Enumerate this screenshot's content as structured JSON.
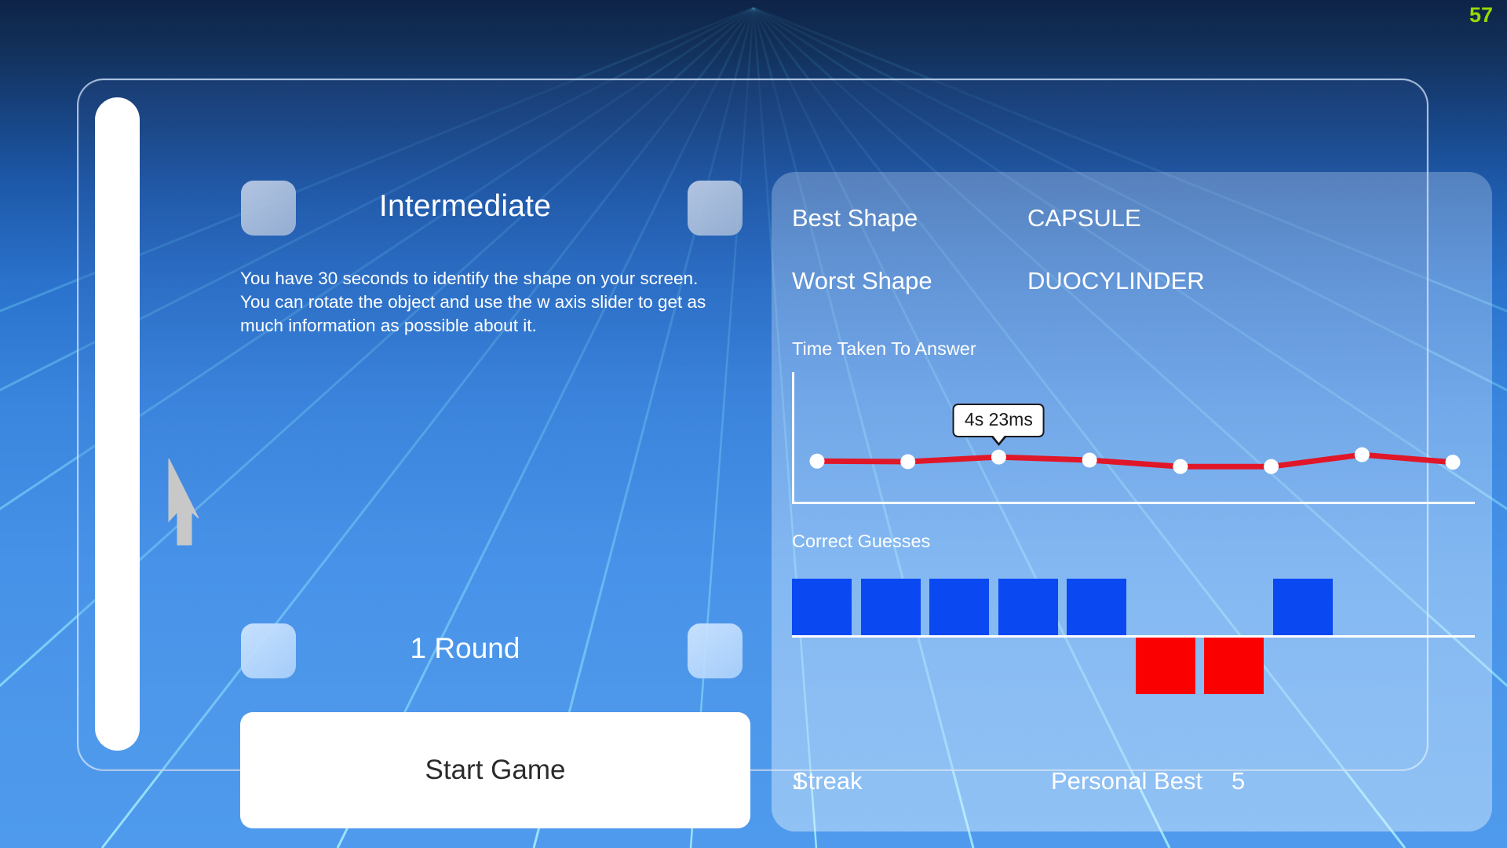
{
  "hud": {
    "score": "57"
  },
  "left": {
    "difficulty": "Intermediate",
    "description": "You have 30 seconds to identify the shape on your screen. You can rotate the object and use the w axis slider to get as much information as possible about it.",
    "rounds": "1 Round",
    "start_label": "Start Game",
    "prev_difficulty_icon": "left-arrow-icon",
    "next_difficulty_icon": "right-arrow-icon",
    "prev_round_icon": "left-arrow-icon",
    "next_round_icon": "right-arrow-icon",
    "slider_name": "w-axis-slider"
  },
  "stats": {
    "best_shape_label": "Best Shape",
    "best_shape_value": "CAPSULE",
    "worst_shape_label": "Worst Shape",
    "worst_shape_value": "DUOCYLINDER",
    "time_chart_title": "Time Taken To Answer",
    "guesses_title": "Correct Guesses",
    "tooltip": "4s 23ms",
    "streak_label": "Streak",
    "streak_value": "1",
    "personal_best_label": "Personal Best",
    "personal_best_value": "5"
  },
  "colors": {
    "line": "#e01728",
    "point": "#ffffff",
    "correct": "#0a49f2",
    "wrong": "#fb0000",
    "score": "#96d900",
    "panel_border": "#deecff"
  },
  "chart_data": [
    {
      "type": "line",
      "title": "Time Taken To Answer",
      "xlabel": "",
      "ylabel": "",
      "grid": false,
      "legend": null,
      "annotations": [
        {
          "index": 2,
          "text": "4s 23ms"
        }
      ],
      "x": [
        1,
        2,
        3,
        4,
        5,
        6,
        7,
        8
      ],
      "values": [
        4.0,
        3.95,
        4.38,
        4.1,
        3.5,
        3.5,
        4.6,
        3.9
      ],
      "series": [
        {
          "name": "Time Taken To Answer",
          "values": [
            4.0,
            3.95,
            4.38,
            4.1,
            3.5,
            3.5,
            4.6,
            3.9
          ]
        }
      ],
      "ylim": [
        0,
        12
      ]
    },
    {
      "type": "bar",
      "title": "Correct Guesses",
      "xlabel": "",
      "ylabel": "",
      "grid": false,
      "categories": [
        "1",
        "2",
        "3",
        "4",
        "5",
        "6",
        "7",
        "8"
      ],
      "values": [
        1,
        1,
        1,
        1,
        1,
        -1,
        -1,
        1
      ],
      "value_labels": [
        "correct",
        "correct",
        "correct",
        "correct",
        "correct",
        "wrong",
        "wrong",
        "correct"
      ],
      "ylim": [
        -1,
        1
      ]
    }
  ]
}
